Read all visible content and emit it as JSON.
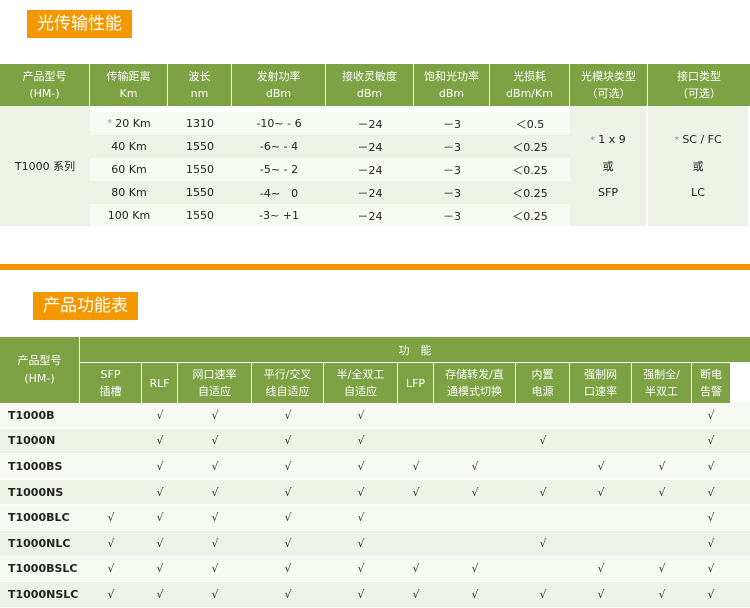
{
  "section1": {
    "title": "光传输性能"
  },
  "table1": {
    "headers": [
      [
        "产品型号",
        "(HM-)"
      ],
      [
        "传输距离",
        "Km"
      ],
      [
        "波长",
        "nm"
      ],
      [
        "发射功率",
        "dBm"
      ],
      [
        "接收灵敏度",
        "dBm"
      ],
      [
        "饱和光功率",
        "dBm"
      ],
      [
        "光损耗",
        "dBm/Km"
      ],
      [
        "光模块类型",
        "（可选）"
      ],
      [
        "接口类型",
        "（可选）"
      ]
    ],
    "model": "T1000 系列",
    "rows": [
      {
        "dist": "20 Km",
        "star": "*",
        "wave": "1310",
        "tx": "-10~ - 6",
        "rx": "－24",
        "sat": "－3",
        "loss": "＜0.5"
      },
      {
        "dist": "40 Km",
        "wave": "1550",
        "tx": "-6~ - 4",
        "rx": "－24",
        "sat": "－3",
        "loss": "＜0.25"
      },
      {
        "dist": "60 Km",
        "wave": "1550",
        "tx": "-5~ - 2",
        "rx": "－24",
        "sat": "－3",
        "loss": "＜0.25"
      },
      {
        "dist": "80 Km",
        "wave": "1550",
        "tx": "-4~　0",
        "rx": "－24",
        "sat": "－3",
        "loss": "＜0.25"
      },
      {
        "dist": "100 Km",
        "wave": "1550",
        "tx": "-3~ +1",
        "rx": "－24",
        "sat": "－3",
        "loss": "＜0.25"
      }
    ],
    "module": {
      "star": "*",
      "line1": "1 x 9",
      "line2": "或",
      "line3": "SFP"
    },
    "interface": {
      "star": "*",
      "line1": "SC / FC",
      "line2": "或",
      "line3": "LC"
    }
  },
  "section2": {
    "title": "产品功能表"
  },
  "table2": {
    "model_header": [
      "产品型号",
      "(HM-)"
    ],
    "group_header": "功　能",
    "columns": [
      [
        "SFP",
        "插槽"
      ],
      [
        "RLF",
        ""
      ],
      [
        "网口速率",
        "自适应"
      ],
      [
        "平行/交叉",
        "线自适应"
      ],
      [
        "半/全双工",
        "自适应"
      ],
      [
        "LFP",
        ""
      ],
      [
        "存储转发/直",
        "通模式切换"
      ],
      [
        "内置",
        "电源"
      ],
      [
        "强制网",
        "口速率"
      ],
      [
        "强制全/",
        "半双工"
      ],
      [
        "断电",
        "告警"
      ]
    ],
    "check_mark": "√",
    "rows": [
      {
        "model": "T1000B",
        "checks": [
          0,
          1,
          1,
          1,
          1,
          0,
          0,
          0,
          0,
          0,
          1
        ]
      },
      {
        "model": "T1000N",
        "checks": [
          0,
          1,
          1,
          1,
          1,
          0,
          0,
          1,
          0,
          0,
          1
        ]
      },
      {
        "model": "T1000BS",
        "checks": [
          0,
          1,
          1,
          1,
          1,
          1,
          1,
          0,
          1,
          1,
          1
        ]
      },
      {
        "model": "T1000NS",
        "checks": [
          0,
          1,
          1,
          1,
          1,
          1,
          1,
          1,
          1,
          1,
          1
        ]
      },
      {
        "model": "T1000BLC",
        "checks": [
          1,
          1,
          1,
          1,
          1,
          0,
          0,
          0,
          0,
          0,
          1
        ]
      },
      {
        "model": "T1000NLC",
        "checks": [
          1,
          1,
          1,
          1,
          1,
          0,
          0,
          1,
          0,
          0,
          1
        ]
      },
      {
        "model": "T1000BSLC",
        "checks": [
          1,
          1,
          1,
          1,
          1,
          1,
          1,
          0,
          1,
          1,
          1
        ]
      },
      {
        "model": "T1000NSLC",
        "checks": [
          1,
          1,
          1,
          1,
          1,
          1,
          1,
          1,
          1,
          1,
          1
        ]
      }
    ]
  }
}
